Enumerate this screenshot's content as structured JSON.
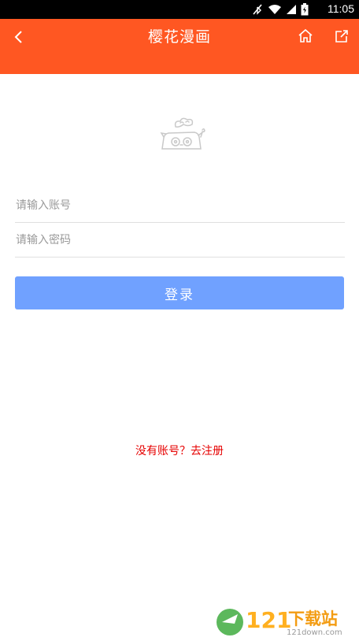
{
  "status_bar": {
    "time": "11:05",
    "icons": [
      "signal-muted-icon",
      "wifi-icon",
      "cellular-signal-icon",
      "battery-icon"
    ]
  },
  "header": {
    "title": "樱花漫画",
    "back_icon": "chevron-left-icon",
    "home_icon": "home-icon",
    "share_icon": "share-icon"
  },
  "login_form": {
    "account_placeholder": "请输入账号",
    "password_placeholder": "请输入密码",
    "submit_label": "登录",
    "register_link": "没有账号？去注册"
  },
  "watermark": {
    "number": "121",
    "text": "下载站",
    "subtext": "121down.com"
  },
  "colors": {
    "header": "#ff5722",
    "button": "#70a1ff",
    "link": "#e60000"
  }
}
